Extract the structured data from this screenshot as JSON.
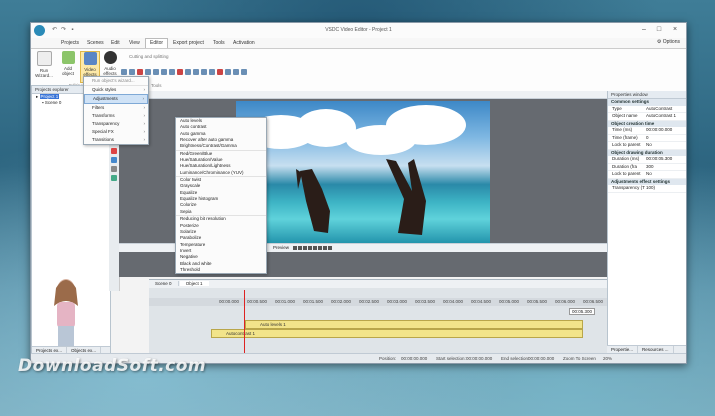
{
  "window": {
    "title": "VSDC Video Editor - Project 1"
  },
  "menu": [
    "Projects",
    "Scenes",
    "Edit",
    "View",
    "Editor",
    "Export project",
    "Tools",
    "Activation"
  ],
  "active_menu_index": 4,
  "options_label": "Options",
  "ribbon": {
    "buttons": [
      {
        "label": "Run Wizard...",
        "icon": "wand-icon"
      },
      {
        "label": "Add object",
        "icon": "add-object-icon"
      },
      {
        "label": "Video effects",
        "icon": "video-effects-icon"
      },
      {
        "label": "Audio effects",
        "icon": "audio-effects-icon"
      }
    ],
    "cutting_label": "Cutting and splitting",
    "group_editing": "Editing",
    "group_tools": "Tools"
  },
  "explorer": {
    "title": "Projects explorer",
    "items": [
      "Project 1",
      "Scene 0"
    ]
  },
  "effects_menu": {
    "header": "Run object's wizard...",
    "items": [
      {
        "label": "Quick styles",
        "arrow": true
      },
      {
        "label": "Adjustments",
        "arrow": true,
        "highlight": true
      },
      {
        "label": "Filters",
        "arrow": true
      },
      {
        "label": "Transforms",
        "arrow": true
      },
      {
        "label": "Transparency",
        "arrow": true
      },
      {
        "label": "Special FX",
        "arrow": true
      },
      {
        "label": "Transitions",
        "arrow": true
      }
    ]
  },
  "adjustments_submenu": [
    "Auto levels",
    "Auto contrast",
    "Auto gamma",
    "Recover after auto gamma",
    "Brightness/Contrast/Gamma",
    "Red/Green/Blue",
    "Hue/Saturation/Value",
    "Hue/Saturation/Lightness",
    "Luminance/Chrominance (YUV)",
    "Color twist",
    "Grayscale",
    "Equalize",
    "Equalize histogram",
    "Colorize",
    "Sepia",
    "Reducing bit resolution",
    "Posterize",
    "Solarize",
    "Parabolize",
    "Temperature",
    "Invert",
    "Negative",
    "Black and white",
    "Threshold"
  ],
  "preview_label": "Preview",
  "timeline": {
    "tabs": [
      "Scene 0",
      "Object 1"
    ],
    "ruler": [
      "00:00.000",
      "00:00.500",
      "00:01.000",
      "00:01.500",
      "00:02.000",
      "00:02.500",
      "00:03.000",
      "00:03.500",
      "00:04.000",
      "00:04.500",
      "00:05.000",
      "00:05.500",
      "00:06.000",
      "00:06.500",
      "00:07.000"
    ],
    "tracks": [
      "Auto levels 1",
      "Autocontrast 1"
    ],
    "end_time": "00:05.300"
  },
  "properties": {
    "title": "Properties window",
    "sections": [
      {
        "name": "Common settings",
        "rows": [
          [
            "Type",
            "AutoContrast"
          ],
          [
            "Object name",
            "AutoContrast 1"
          ]
        ]
      },
      {
        "name": "Object creation time",
        "rows": [
          [
            "Time (ms)",
            "00:00:00.000"
          ],
          [
            "Time (frame)",
            "0"
          ],
          [
            "Lock to parent",
            "No"
          ]
        ]
      },
      {
        "name": "Object drawing duration",
        "rows": [
          [
            "Duration (ms)",
            "00:00:05.300"
          ],
          [
            "Duration (fra",
            "300"
          ],
          [
            "Lock to parent",
            "No"
          ]
        ]
      },
      {
        "name": "Adjustments effect settings",
        "rows": [
          [
            "Transparency (T 100)",
            ""
          ]
        ]
      }
    ]
  },
  "bottom_tabs_left": [
    "Projects ex...",
    "Objects ex..."
  ],
  "bottom_tabs_right": [
    "Propertie...",
    "Resources ..."
  ],
  "status": {
    "position": "Position:",
    "position_val": "00:00:00.000",
    "start_sel": "Start selection:",
    "start_val": "00:00:00.000",
    "end_sel": "End selection:",
    "end_val": "00:00:00.000",
    "zoom": "Zoom To Screen",
    "zoom_val": "20%"
  },
  "watermark": "DownloadSoft.com",
  "colors": {
    "accent": "#3874d8",
    "track": "#f2e48a",
    "highlight": "#cfe2f6",
    "playhead": "#d22222"
  }
}
